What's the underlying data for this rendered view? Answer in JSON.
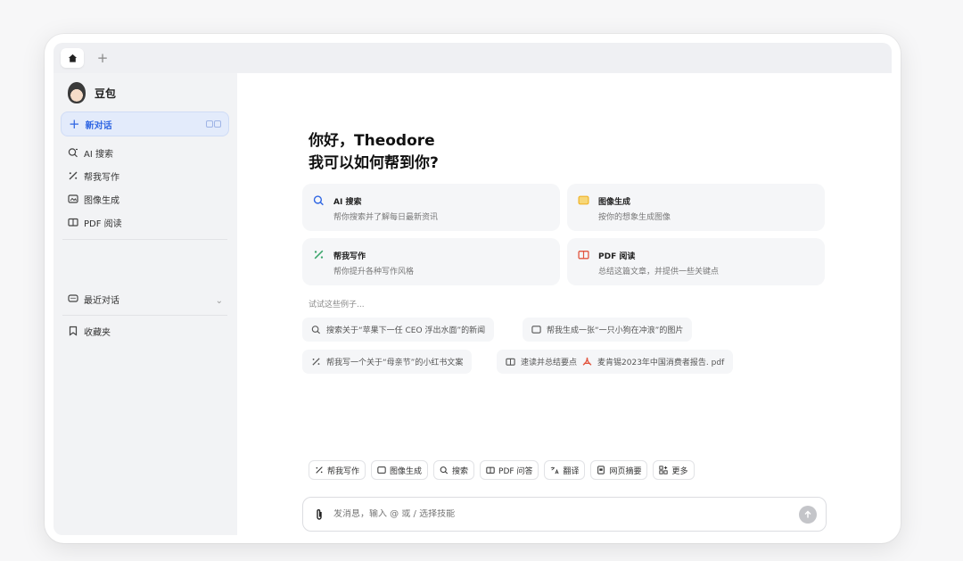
{
  "tabs": {
    "home_icon": "home-icon",
    "add_label": "+"
  },
  "sidebar": {
    "brand": "豆包",
    "new_chat": "新对话",
    "items": [
      {
        "label": "AI 搜索",
        "icon": "search-icon"
      },
      {
        "label": "帮我写作",
        "icon": "pen-icon"
      },
      {
        "label": "图像生成",
        "icon": "image-icon"
      },
      {
        "label": "PDF 阅读",
        "icon": "book-icon"
      }
    ],
    "recent": "最近对话",
    "favorites": "收藏夹"
  },
  "main": {
    "greeting_line1": "你好，Theodore",
    "greeting_line2": "我可以如何帮到你?",
    "cards": [
      {
        "title": "AI 搜索",
        "desc": "帮你搜索并了解每日最新资讯",
        "icon": "search-icon",
        "color": "#2f66e3"
      },
      {
        "title": "图像生成",
        "desc": "按你的想象生成图像",
        "icon": "image-icon",
        "color": "#f0b429"
      },
      {
        "title": "帮我写作",
        "desc": "帮你提升各种写作风格",
        "icon": "pen-icon",
        "color": "#3aa56b"
      },
      {
        "title": "PDF 阅读",
        "desc": "总结这篇文章，并提供一些关键点",
        "icon": "book-icon",
        "color": "#e2553f"
      }
    ],
    "try_label": "试试这些例子...",
    "examples": [
      "搜索关于“苹果下一任 CEO 浮出水面”的新闻",
      "帮我生成一张“一只小狗在冲浪”的图片",
      "帮我写一个关于“母亲节”的小红书文案",
      "速读并总结要点",
      "麦肯锡2023年中国消费者报告. pdf"
    ]
  },
  "toolbar": [
    "帮我写作",
    "图像生成",
    "搜索",
    "PDF 问答",
    "翻译",
    "网页摘要",
    "更多"
  ],
  "input": {
    "placeholder": "发消息，输入 @ 或 / 选择技能"
  }
}
